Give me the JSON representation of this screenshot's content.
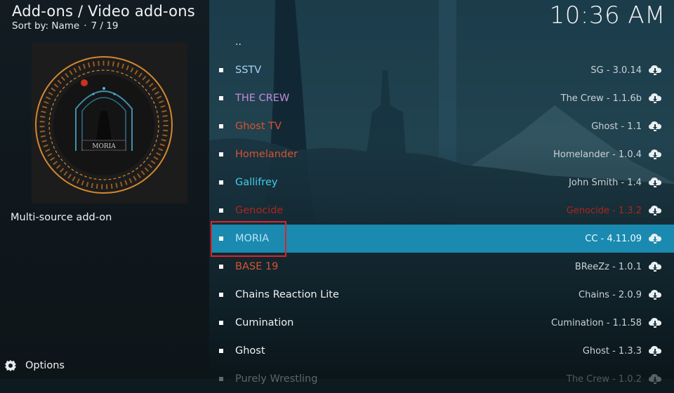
{
  "header": {
    "breadcrumb": "Add-ons / Video add-ons",
    "sort_label": "Sort by: Name",
    "position": "7 / 19",
    "clock": "10:36 AM"
  },
  "sidebar": {
    "description": "Multi-source add-on",
    "options_label": "Options",
    "thumbnail_caption": "MORIA"
  },
  "list": {
    "parent": "..",
    "items": [
      {
        "name": "SSTV",
        "version": "SG - 3.0.14",
        "name_color": "#a9d3f5",
        "icon": "cloud-download-icon"
      },
      {
        "name": "THE CREW",
        "version": "The Crew - 1.1.6b",
        "name_color": "#c48bd8",
        "icon": "cloud-download-icon"
      },
      {
        "name": "Ghost TV",
        "version": "Ghost - 1.1",
        "name_color": "#d9522f",
        "icon": "cloud-download-icon"
      },
      {
        "name": "Homelander",
        "version": "Homelander - 1.0.4",
        "name_color": "#d9522f",
        "icon": "cloud-download-icon"
      },
      {
        "name": "Gallifrey",
        "version": "John Smith - 1.4",
        "name_color": "#3fd0ec",
        "icon": "cloud-download-icon"
      },
      {
        "name": "Genocide",
        "version": "Genocide - 1.3.2",
        "name_color": "#b0241c",
        "version_prefix_color": "#b0241c",
        "icon": "cloud-download-icon"
      },
      {
        "name": "MORIA",
        "version": "CC - 4.11.09",
        "name_color": "#b9e3f5",
        "selected": true,
        "icon": "cloud-download-icon"
      },
      {
        "name": "BASE 19",
        "version": "BReeZz - 1.0.1",
        "name_color": "#d9522f",
        "icon": "cloud-download-icon"
      },
      {
        "name": "Chains Reaction Lite",
        "version": "Chains - 2.0.9",
        "name_color": "#eef2f3",
        "icon": "cloud-download-icon"
      },
      {
        "name": "Cumination",
        "version": "Cumination - 1.1.58",
        "name_color": "#eef2f3",
        "icon": "cloud-download-icon"
      },
      {
        "name": "Ghost",
        "version": "Ghost - 1.3.3",
        "name_color": "#eef2f3",
        "icon": "cloud-download-icon"
      },
      {
        "name": "Purely Wrestling",
        "version": "The Crew - 1.0.2",
        "name_color": "#eef2f3",
        "icon": "cloud-download-icon"
      }
    ]
  },
  "colors": {
    "selection": "#1a8ab0",
    "highlight_box": "#d8262c"
  }
}
